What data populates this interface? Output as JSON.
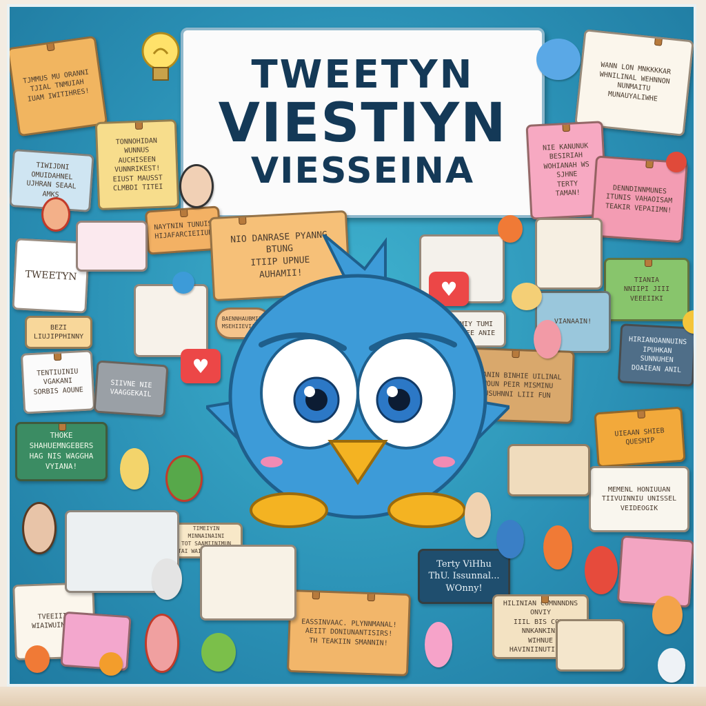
{
  "title": {
    "line1": "TWEETYN",
    "line2": "VIESTIYN",
    "line3": "VIESSEINA"
  },
  "notes": {
    "top_left": "TJMMUS MU ORANNI\nTJIAL TNMUIAH\nIUAM IWITIHRES!",
    "left_blue": "TIWIJDNI OMUIDAHNEL\nUJHRAN SEAAL AMKS",
    "yellow_mid": "TONNOHIDAN WUNNUS\nAUCHISEEN VUNNRIKEST!\nEIUST MAUSST\nCLMBDI TITEI",
    "left_tweetyn": "TWEETYN",
    "orange_center": "NAYTNIN TUNUIS\nHIJAFARCIEIIUN",
    "big_orange": "NIO DANRASE PYANNG BTUNG\nITIIP UPNUE\nAUHAMII!",
    "pink_right": "NIE KANUNUK BESIRIAH\nWOHIANAH WS SJHNE\nTERTY\nTAMAN!",
    "pink_right2": "DENNDINNMUNES\nITUNIS VAHAOISAM\nTEAKIR VEPAIIMN!",
    "top_right": "WANN LON MNKKKKAR\nWHNILINAL WEHNNON\nNUNMAITU\nMUNAUYALIWHE",
    "green_right": "TIANIA\nNNIIPI JIII\nVEEEIIKI",
    "blue_right": "VIANAAIN!",
    "navy_right": "HIRIANOANNUINS\nIPUHKAN SUNNUHEN\nDOAIEAN ANIL",
    "left_bezi": "BEZI\nLIUJIPPHINNY",
    "left_white": "TENTIUINIU VGAKANI\nSORBIS AOUNE",
    "grey_left": "SIIVNE NIE\nVAAGGEKAIL",
    "green_left": "THOKE SHAHUEMNGEBERS\nHAG NIS WAGGHA\nVYIANA!",
    "wood_center": "TIMHANIN BINHIE UILINAL\nRIWOUN PEIR MISMINU\nDOUSUHNNI LIII FUN",
    "orange_right": "UIEAAN SHIEB\nQUESMIP",
    "white_right": "MEMENL HONIUUAN\nTIIVUINNIU UNISSEL\nVEIDEOGIK",
    "small_center": "TIMEIYIN MINNAINAINI\nTOT SAAMIINIMUN\nTAI WAIN MEHNRIEL",
    "navy_center": "Terty ViHhu\nThU. Issunnal...\nWOnny!",
    "bottom_orange": "EASSINVAAC. PLYNNMANAL!\nAEIIT DONIUNANTISIRS!\nTH TEAKIIN SMANNIN!",
    "bottom_right": "HILINIAN COMNNNDNS ONVIY\nIIIL BIS COMN NNKANKINS\nWIHNUE HAVINIINUTIIBII",
    "bottom_left": "TVEEIIIN\nWIAIWUINEUR",
    "speech_center": "MIY TUMI\nVIEE ANIE",
    "speech_left": "BAENNHAUBMIIN\nMSEHIIEVIANEN"
  },
  "colors": {
    "board": "#2a8fb4",
    "title_text": "#143957",
    "mascot_body": "#3d9bd8",
    "beak": "#f4b322",
    "heart": "#ec4747"
  },
  "icons": [
    "lightbulb-icon",
    "heart-icon",
    "bird-mascot-icon"
  ]
}
